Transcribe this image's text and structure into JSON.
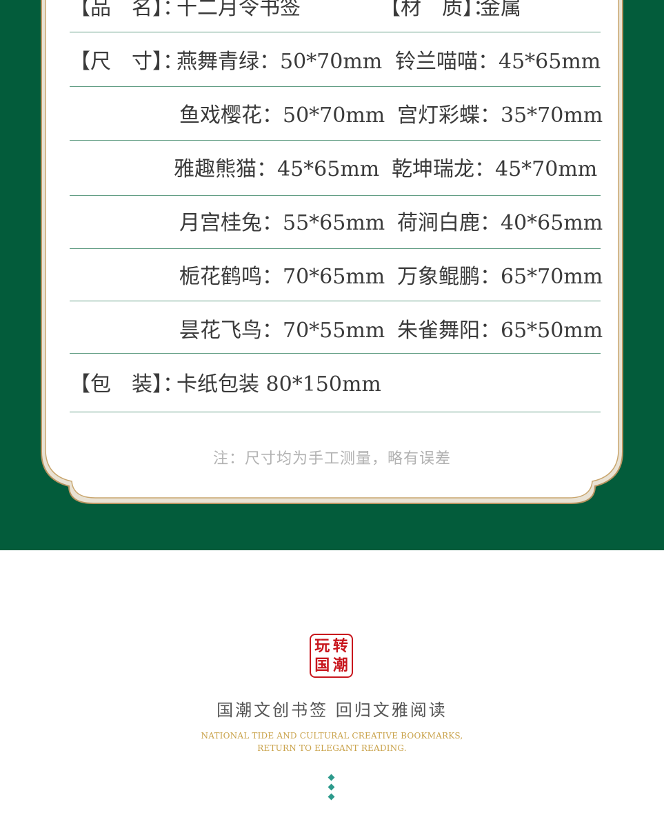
{
  "specs": {
    "name": {
      "key": "【品　名】：",
      "value": "十二月令书签"
    },
    "material": {
      "key": "【材　质】：",
      "value": "金属"
    },
    "size_key": "【尺　寸】：",
    "sizes": [
      [
        "燕舞青绿：50*70mm",
        "铃兰喵喵：45*65mm"
      ],
      [
        "鱼戏樱花：50*70mm",
        "宫灯彩蝶：35*70mm"
      ],
      [
        "雅趣熊猫：45*65mm",
        "乾坤瑞龙：45*70mm"
      ],
      [
        "月宫桂兔：55*65mm",
        "荷涧白鹿：40*65mm"
      ],
      [
        "栀花鹤鸣：70*65mm",
        "万象鲲鹏：65*70mm"
      ],
      [
        "昙花飞鸟：70*55mm",
        "朱雀舞阳：65*50mm"
      ]
    ],
    "packaging": {
      "key": "【包　装】：",
      "value": "卡纸包装  80*150mm"
    },
    "note": "注：尺寸均为手工测量，略有误差"
  },
  "seal": {
    "chars": [
      "玩",
      "转",
      "国",
      "潮"
    ]
  },
  "slogan": {
    "cn": "国潮文创书签  回归文雅阅读",
    "en_line1": "NATIONAL TIDE AND CULTURAL CREATIVE BOOKMARKS,",
    "en_line2": "RETURN TO ELEGANT READING."
  },
  "colors": {
    "green": "#035c3b",
    "gold": "#c9a24a",
    "seal_red": "#c8161d",
    "accent_teal": "#2d9a8c"
  }
}
